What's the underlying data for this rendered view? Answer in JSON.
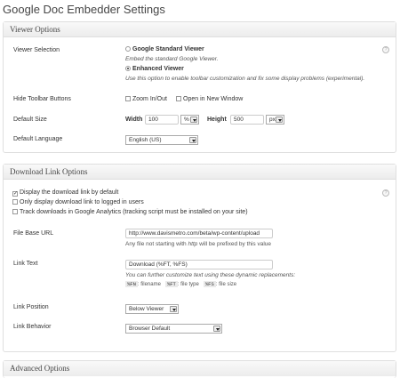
{
  "page_title": "Google Doc Embedder Settings",
  "viewer_options": {
    "heading": "Viewer Options",
    "viewer_selection_label": "Viewer Selection",
    "standard_label": "Google Standard Viewer",
    "standard_desc": "Embed the standard Google Viewer.",
    "enhanced_label": "Enhanced Viewer",
    "enhanced_desc": "Use this option to enable toolbar customization and fix some display problems (experimental).",
    "selected": "enhanced",
    "hide_toolbar_label": "Hide Toolbar Buttons",
    "zoom_label": "Zoom In/Out",
    "open_new_window_label": "Open in New Window",
    "default_size_label": "Default Size",
    "width_label": "Width",
    "width_value": "100",
    "width_unit": "%",
    "height_label": "Height",
    "height_value": "500",
    "height_unit": "px",
    "default_language_label": "Default Language",
    "language_value": "English (US)"
  },
  "download_options": {
    "heading": "Download Link Options",
    "display_default_label": "Display the download link by default",
    "display_default_checked": true,
    "logged_in_label": "Only display download link to logged in users",
    "logged_in_checked": false,
    "track_label": "Track downloads in Google Analytics (tracking script must be installed on your site)",
    "track_checked": false,
    "file_base_label": "File Base URL",
    "file_base_value": "http://www.davismetro.com/beta/wp-content/upload",
    "file_base_desc_prefix": "Any file not starting with ",
    "file_base_desc_em": "http",
    "file_base_desc_suffix": " will be prefixed by this value",
    "link_text_label": "Link Text",
    "link_text_value": "Download (%FT, %FS)",
    "link_text_desc": "You can further customize text using these dynamic replacements:",
    "tokens": [
      {
        "code": "%FN",
        "desc": ": filename"
      },
      {
        "code": "%FT",
        "desc": ": file type"
      },
      {
        "code": "%FS",
        "desc": ": file size"
      }
    ],
    "link_position_label": "Link Position",
    "link_position_value": "Below Viewer",
    "link_behavior_label": "Link Behavior",
    "link_behavior_value": "Browser Default"
  },
  "advanced_options": {
    "heading": "Advanced Options"
  },
  "help_glyph": "?"
}
